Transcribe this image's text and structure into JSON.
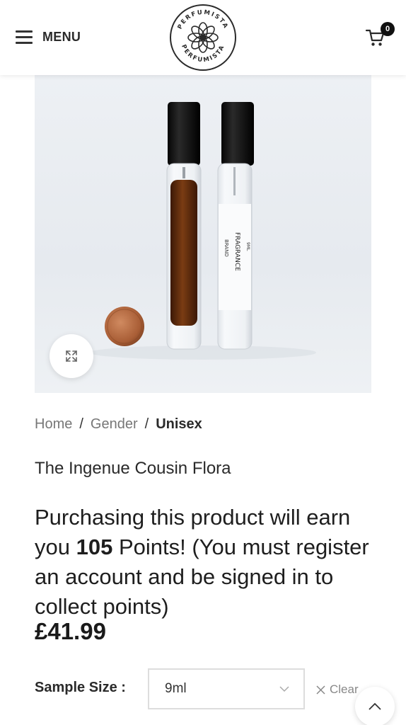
{
  "header": {
    "menu_label": "MENU",
    "cart_count": "0",
    "logo_text_top": "PERFUMISTA",
    "logo_text_bottom": "PERFUMISTA"
  },
  "product_image": {
    "bottle_label_brand": "BRAND",
    "bottle_label_fragrance": "FRAGRANCE",
    "bottle_label_volume": "9ML"
  },
  "breadcrumb": {
    "home": "Home",
    "separator": "/",
    "gender": "Gender",
    "current": "Unisex"
  },
  "product": {
    "title": "The Ingenue Cousin Flora",
    "points_prefix": "Purchasing this product will earn you ",
    "points_value": "105",
    "points_suffix": " Points! (You must register an account and be signed in to collect points)",
    "price": "£41.99"
  },
  "variation": {
    "label": "Sample Size",
    "label_colon": ":",
    "selected": "9ml",
    "clear_label": "Clear"
  },
  "colors": {
    "accent": "#111111",
    "liquid": "#5a2a0c",
    "coin": "#b5683f"
  }
}
